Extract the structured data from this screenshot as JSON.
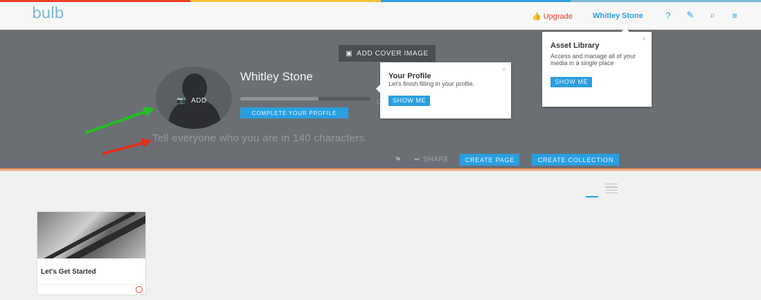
{
  "colors": {
    "accent": "#2a9fe0",
    "upgrade": "#e8412c",
    "hero_bg": "#6b6f74",
    "stripe": [
      "#e8412c",
      "#f3c33a",
      "#2a9fe0",
      "#7bb6d4"
    ]
  },
  "header": {
    "logo": "bulb",
    "upgrade_label": "Upgrade",
    "upgrade_icon": "thumbs-up-icon",
    "user_name": "Whitley Stone",
    "icons": [
      "help-icon",
      "edit-icon",
      "search-icon",
      "menu-icon"
    ]
  },
  "hero": {
    "cover_button": "ADD COVER IMAGE",
    "avatar_add_label": "ADD",
    "profile_name": "Whitley Stone",
    "profile_progress": 0.6,
    "progress_label": "C",
    "complete_button": "COMPLETE YOUR PROFILE",
    "bio_placeholder": "Tell everyone who you are in 140 characters.",
    "share_label": "SHARE",
    "create_page_button": "CREATE PAGE",
    "create_collection_button": "CREATE COLLECTION"
  },
  "tooltips": {
    "profile": {
      "title": "Your Profile",
      "description": "Let's finish filling in your profile.",
      "button": "SHOW ME",
      "close": "×"
    },
    "asset": {
      "title": "Asset Library",
      "description": "Access and manage all of your media in a single place",
      "button": "SHOW ME",
      "close": "×"
    }
  },
  "annotations": {
    "green_arrow_color": "#22c022",
    "red_arrow_color": "#e0301e"
  },
  "card": {
    "title": "Let's Get Started"
  }
}
